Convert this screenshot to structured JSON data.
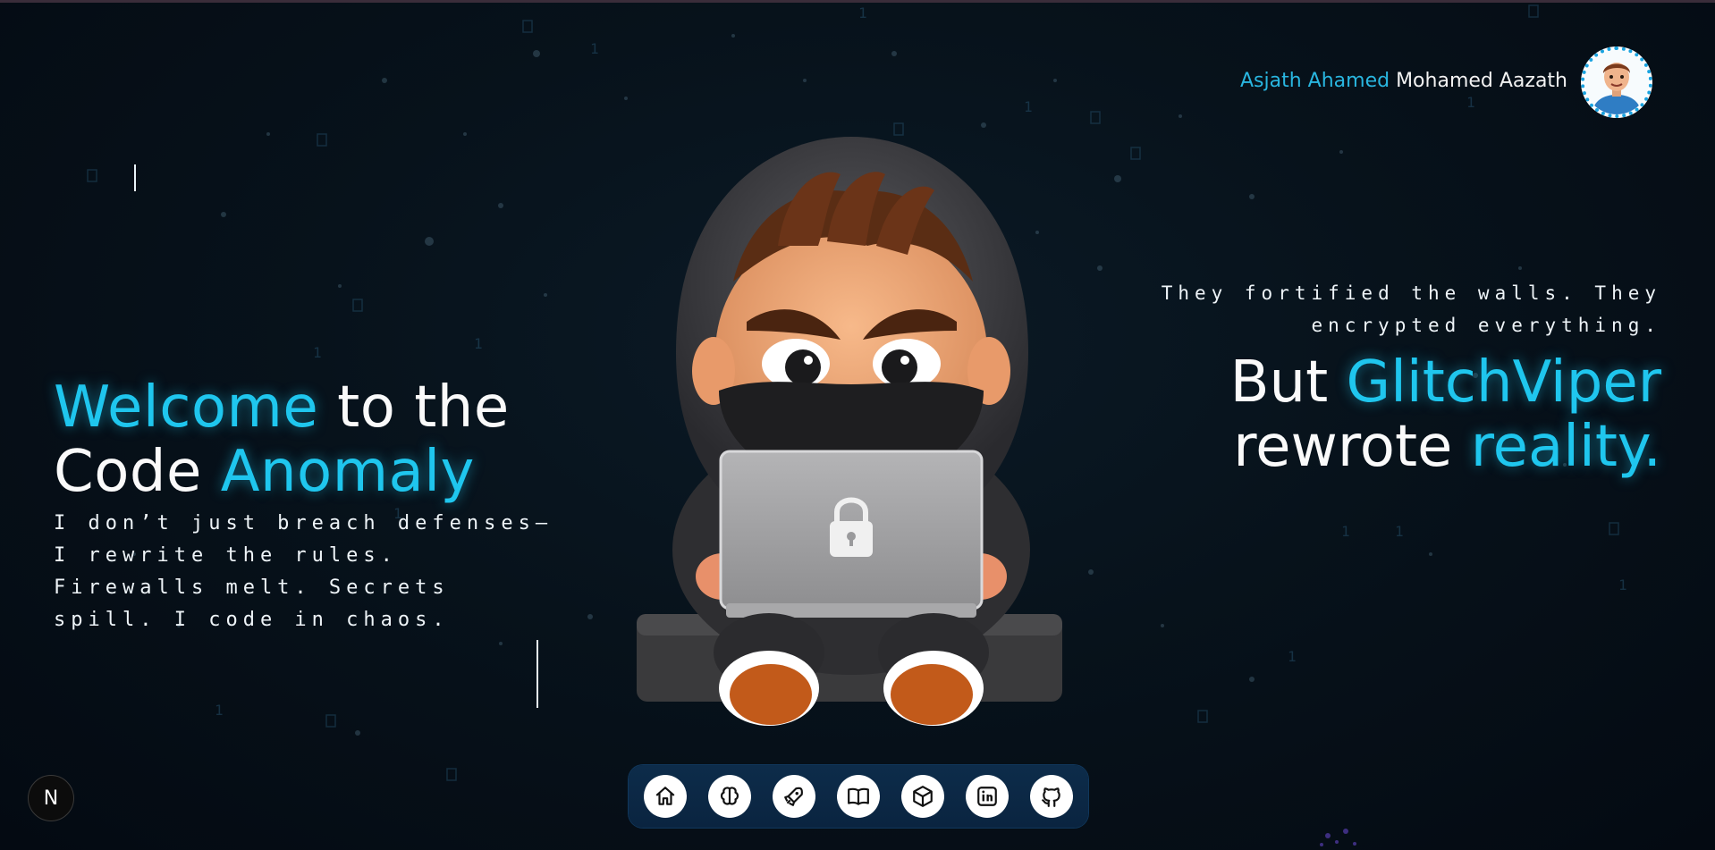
{
  "header": {
    "name_first": "Asjath Ahamed",
    "name_last": "Mohamed Aazath",
    "avatar_icon": "avatar-icon"
  },
  "left": {
    "welcome_1": "Welcome",
    "welcome_2": " to the",
    "welcome_3": "Code ",
    "welcome_4": "Anomaly",
    "subtitle": "I don’t just breach defenses— I rewrite the rules. Firewalls melt. Secrets spill. I code in chaos."
  },
  "right": {
    "subtitle": "They fortified the walls. They encrypted everything.",
    "line1_a": "But ",
    "line1_b": "GlitchViper",
    "line2_a": "rewrote ",
    "line2_b": "reality."
  },
  "dock": {
    "items": [
      {
        "icon": "home-icon"
      },
      {
        "icon": "brain-icon"
      },
      {
        "icon": "rocket-icon"
      },
      {
        "icon": "book-icon"
      },
      {
        "icon": "cube-icon"
      },
      {
        "icon": "linkedin-icon"
      },
      {
        "icon": "github-icon"
      }
    ]
  },
  "badge": {
    "label": "N"
  },
  "colors": {
    "accent": "#1fc6ee",
    "dock": "#0d2c4a",
    "background": "#07121b"
  }
}
